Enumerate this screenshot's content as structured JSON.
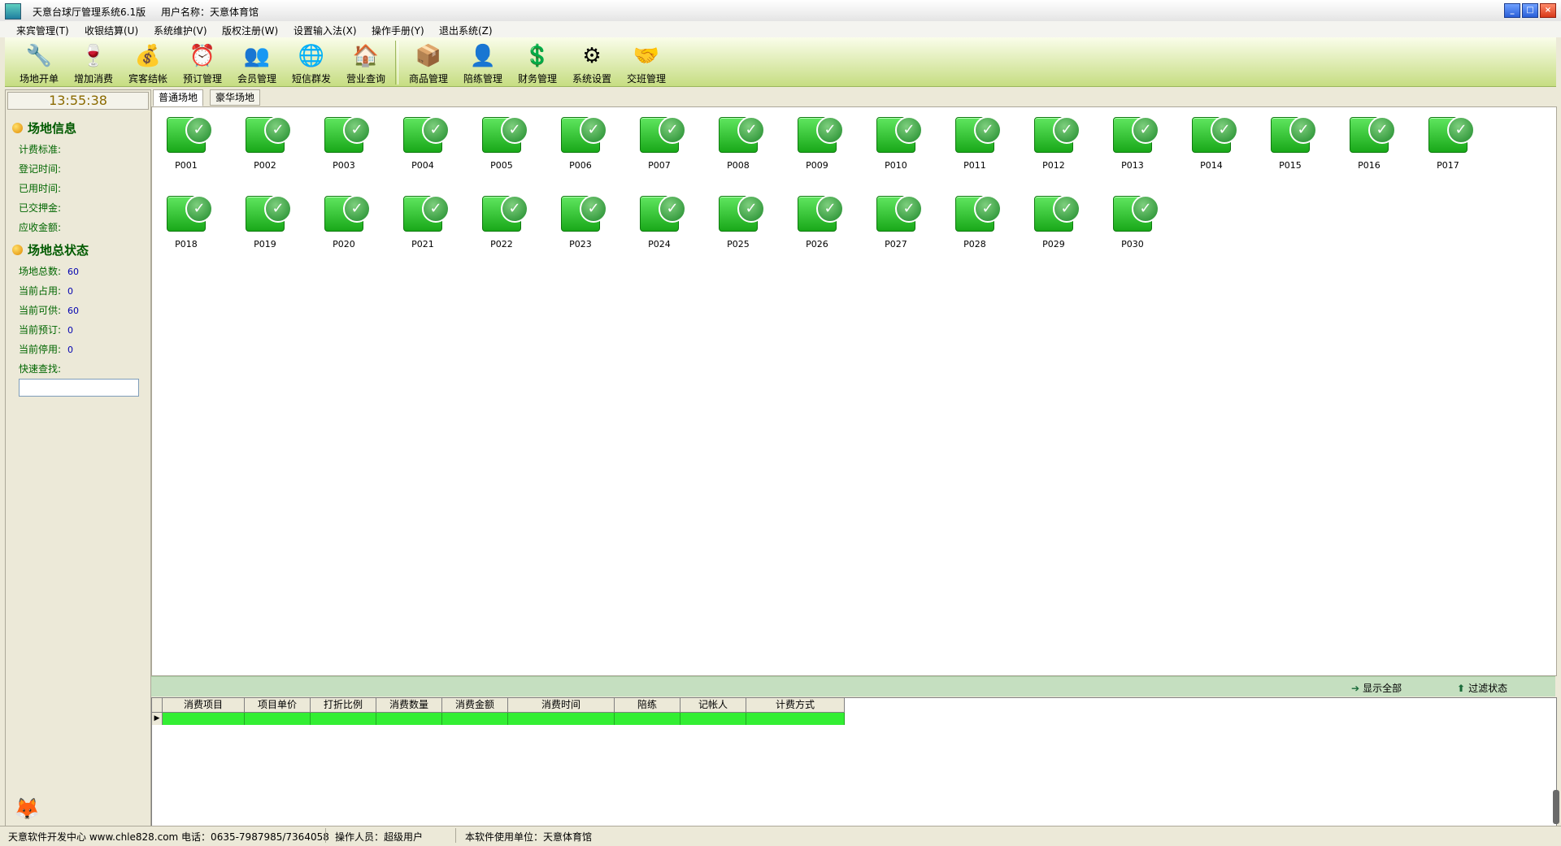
{
  "window": {
    "title": "天意台球厅管理系统6.1版",
    "user": "用户名称：天意体育馆",
    "buttons": [
      "_",
      "□",
      "×"
    ]
  },
  "menu": [
    "来宾管理(T)",
    "收银结算(U)",
    "系统维护(V)",
    "版权注册(W)",
    "设置输入法(X)",
    "操作手册(Y)",
    "退出系统(Z)"
  ],
  "toolbar": [
    {
      "label": "场地开单",
      "icon": "wrench-pencil-icon",
      "glyph": "🔧"
    },
    {
      "label": "增加消费",
      "icon": "wine-bottle-icon",
      "glyph": "🍷"
    },
    {
      "label": "宾客结帐",
      "icon": "coins-icon",
      "glyph": "💰"
    },
    {
      "label": "预订管理",
      "icon": "alarm-clock-icon",
      "glyph": "⏰"
    },
    {
      "label": "会员管理",
      "icon": "members-icon",
      "glyph": "👥"
    },
    {
      "label": "短信群发",
      "icon": "globe-icon",
      "glyph": "🌐"
    },
    {
      "label": "营业查询",
      "icon": "house-search-icon",
      "glyph": "🏠"
    },
    {
      "label": "商品管理",
      "icon": "goods-box-icon",
      "glyph": "📦"
    },
    {
      "label": "陪练管理",
      "icon": "face-icon",
      "glyph": "👤"
    },
    {
      "label": "财务管理",
      "icon": "dollar-icon",
      "glyph": "💲"
    },
    {
      "label": "系统设置",
      "icon": "settings-icon",
      "glyph": "⚙"
    },
    {
      "label": "交班管理",
      "icon": "handshake-icon",
      "glyph": "🤝"
    }
  ],
  "clock": "13:55:38",
  "sidebar": {
    "venue_info_title": "场地信息",
    "venue_info": [
      "计费标准:",
      "登记时间:",
      "已用时间:",
      "已交押金:",
      "应收金额:"
    ],
    "status_title": "场地总状态",
    "status_rows": [
      {
        "label": "场地总数:",
        "value": "60"
      },
      {
        "label": "当前占用:",
        "value": "0"
      },
      {
        "label": "当前可供:",
        "value": "60"
      },
      {
        "label": "当前预订:",
        "value": "0"
      },
      {
        "label": "当前停用:",
        "value": "0"
      }
    ],
    "quick_search_label": "快速查找:",
    "quick_search_value": ""
  },
  "tabs": [
    "普通场地",
    "豪华场地"
  ],
  "rooms": [
    "P001",
    "P002",
    "P003",
    "P004",
    "P005",
    "P006",
    "P007",
    "P008",
    "P009",
    "P010",
    "P011",
    "P012",
    "P013",
    "P014",
    "P015",
    "P016",
    "P017",
    "P018",
    "P019",
    "P020",
    "P021",
    "P022",
    "P023",
    "P024",
    "P025",
    "P026",
    "P027",
    "P028",
    "P029",
    "P030"
  ],
  "filter": {
    "show_all": "显示全部",
    "filter_status": "过滤状态"
  },
  "grid": {
    "columns": [
      "消费项目",
      "项目单价",
      "打折比例",
      "消费数量",
      "消费金额",
      "消费时间",
      "陪练",
      "记帐人",
      "计费方式"
    ]
  },
  "statusbar": {
    "developer": "天意软件开发中心 www.chle828.com 电话：0635-7987985/7364058",
    "operator": "操作人员：超级用户",
    "licensee": "本软件使用单位：天意体育馆"
  },
  "colors": {
    "room_available": "#19a819",
    "toolbar_bg": "#c6dd82",
    "clock_text": "#8b6a00"
  }
}
